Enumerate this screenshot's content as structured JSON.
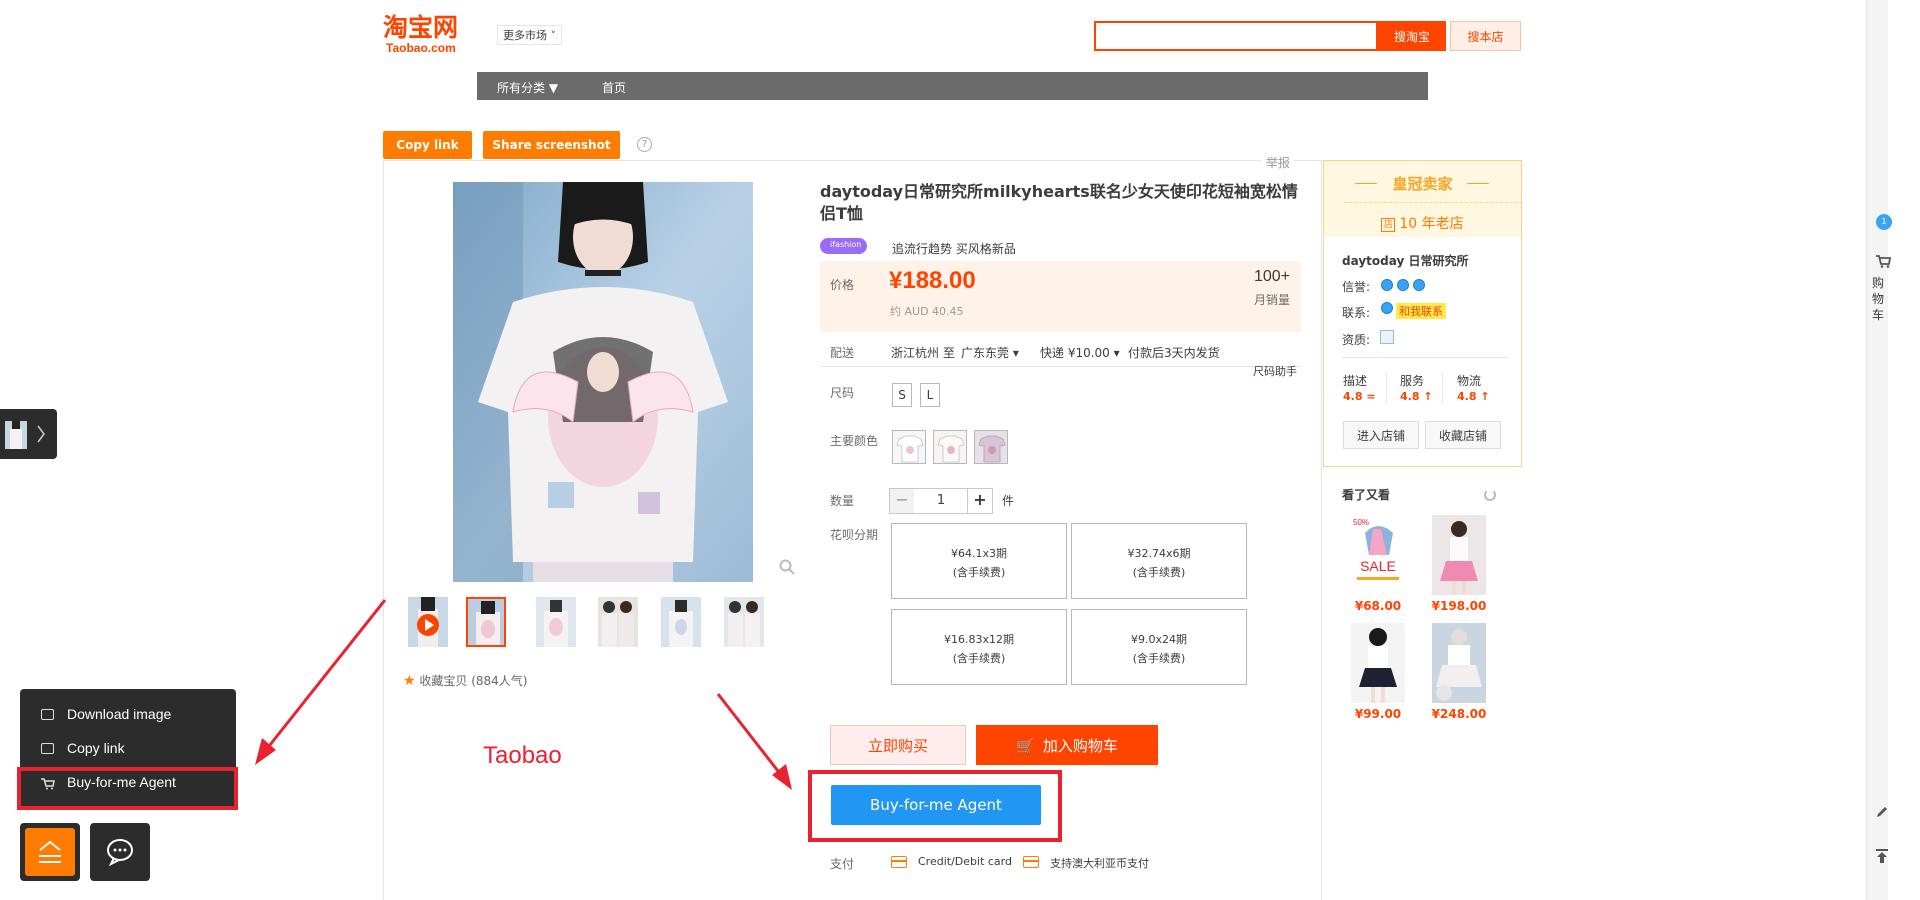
{
  "header": {
    "logo_cn": "淘宝网",
    "logo_en": "Taobao.com",
    "market": "更多市场",
    "search_placeholder": "",
    "search_button": "搜淘宝",
    "shop_search_button": "搜本店"
  },
  "nav": {
    "all_categories": "所有分类 ▼",
    "home": "首页"
  },
  "actions": {
    "copy_link": "Copy link",
    "share_screenshot": "Share screenshot",
    "help": "?"
  },
  "report": "举报",
  "product": {
    "title": "daytoday日常研究所milkyhearts联名少女天使印花短袖宽松情侣T恤",
    "badge": "ifashion",
    "tagline": "追流行趋势 买风格新品",
    "price_label": "价格",
    "price": "¥188.00",
    "price_aud": "约 AUD 40.45",
    "sales_count": "100+",
    "sales_label": "月销量",
    "delivery_label": "配送",
    "delivery_route": "浙江杭州 至",
    "delivery_dest": "广东东莞",
    "delivery_fee": "快递 ¥10.00",
    "delivery_time": "付款后3天内发货",
    "size_helper": "尺码助手",
    "size_label": "尺码",
    "sizes": [
      "S",
      "L"
    ],
    "color_label": "主要颜色",
    "qty_label": "数量",
    "qty_value": "1",
    "qty_unit": "件",
    "installment_label": "花呗分期",
    "installments": [
      {
        "amount": "¥64.1x3期",
        "fee": "(含手续费)"
      },
      {
        "amount": "¥32.74x6期",
        "fee": "(含手续费)"
      },
      {
        "amount": "¥16.83x12期",
        "fee": "(含手续费)"
      },
      {
        "amount": "¥9.0x24期",
        "fee": "(含手续费)"
      }
    ],
    "buy_now": "立即购买",
    "add_cart": "加入购物车",
    "agent_button": "Buy-for-me Agent",
    "pay_label": "支付",
    "pay_card": "Credit/Debit card",
    "pay_aud": "支持澳大利亚币支付",
    "favorite": "收藏宝贝 (884人气)"
  },
  "annotation": "Taobao",
  "shop": {
    "crown": "皇冠卖家",
    "years": "10 年老店",
    "years_icon": "店",
    "name": "daytoday 日常研究所",
    "credit_label": "信誉:",
    "contact_label": "联系:",
    "contact_tag": "和我联系",
    "qual_label": "资质:",
    "scores": [
      {
        "label": "描述",
        "value": "4.8 ="
      },
      {
        "label": "服务",
        "value": "4.8 ↑"
      },
      {
        "label": "物流",
        "value": "4.8 ↑"
      }
    ],
    "enter_shop": "进入店铺",
    "fav_shop": "收藏店铺",
    "see_also": "看了又看",
    "sale_text": "SALE",
    "sale_percent": "50%",
    "recommend_prices": [
      "¥68.00",
      "¥198.00",
      "¥99.00",
      "¥248.00"
    ]
  },
  "sidebar": {
    "cart": "购物车",
    "badge": "1"
  },
  "context_menu": {
    "items": [
      "Download image",
      "Copy link",
      "Buy-for-me Agent"
    ]
  },
  "colors": {
    "brand": "#ff4400",
    "orange": "#ff7c00",
    "agent_blue": "#2196f3",
    "highlight_red": "#e8232f"
  }
}
